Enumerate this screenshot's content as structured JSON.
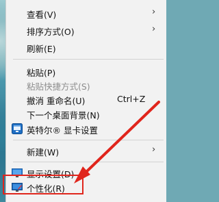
{
  "context_menu": {
    "items": [
      {
        "label": "查看(V)",
        "has_submenu": true
      },
      {
        "label": "排序方式(O)",
        "has_submenu": true
      },
      {
        "label": "刷新(E)"
      },
      {
        "label": "粘贴(P)"
      },
      {
        "label": "粘贴快捷方式(S)",
        "disabled": true
      },
      {
        "label": "撤消 重命名(U)",
        "shortcut": "Ctrl+Z"
      },
      {
        "label": "下一个桌面背景(N)"
      },
      {
        "label": "英特尔® 显卡设置",
        "icon": "intel-graphics-icon"
      },
      {
        "label": "新建(W)",
        "has_submenu": true
      },
      {
        "label": "显示设置(D)",
        "icon": "display-settings-icon"
      },
      {
        "label": "个性化(R)",
        "icon": "personalize-icon"
      }
    ],
    "arrow_glyph": "›"
  },
  "annotation": {
    "highlight_color": "#e0251c",
    "arrow_color": "#e0251c"
  }
}
